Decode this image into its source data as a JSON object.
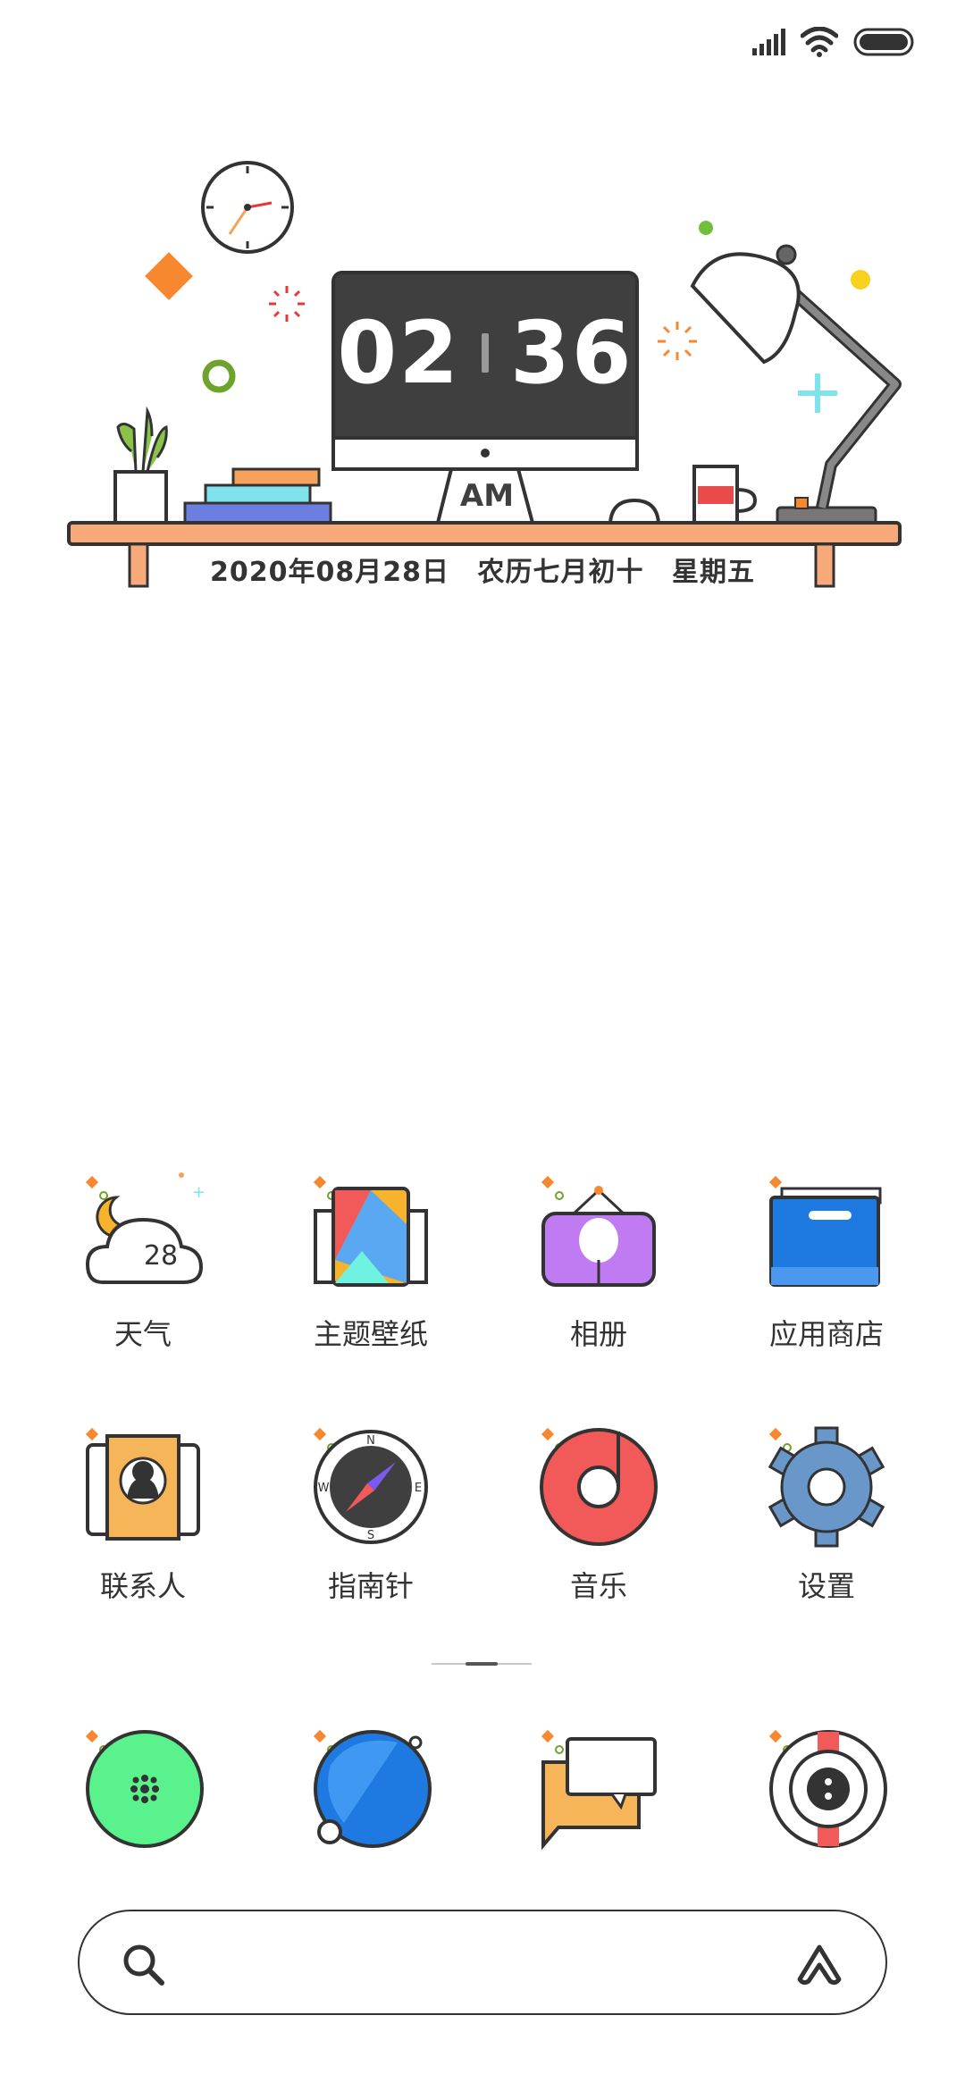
{
  "status_bar": {
    "icons": [
      "signal-icon",
      "wifi-icon",
      "battery-icon"
    ]
  },
  "clock_widget": {
    "hours": "02",
    "minutes": "36",
    "ampm": "AM",
    "date_parts": [
      "2020年08月28日",
      "农历七月初十",
      "星期五"
    ]
  },
  "apps": [
    {
      "name": "天气",
      "icon": "weather-icon",
      "badge": "28"
    },
    {
      "name": "主题壁纸",
      "icon": "themes-icon"
    },
    {
      "name": "相册",
      "icon": "gallery-icon"
    },
    {
      "name": "应用商店",
      "icon": "app-store-icon"
    },
    {
      "name": "联系人",
      "icon": "contacts-icon"
    },
    {
      "name": "指南针",
      "icon": "compass-icon",
      "compass": [
        "N",
        "E",
        "S",
        "W"
      ]
    },
    {
      "name": "音乐",
      "icon": "music-icon"
    },
    {
      "name": "设置",
      "icon": "settings-icon"
    }
  ],
  "dock": [
    {
      "icon": "phone-icon"
    },
    {
      "icon": "browser-icon"
    },
    {
      "icon": "messages-icon"
    },
    {
      "icon": "camera-icon"
    }
  ],
  "search": {
    "placeholder": "",
    "left_icon": "search-icon",
    "right_icon": "assistant-icon"
  },
  "colors": {
    "desk": "#f7a97a",
    "monitor": "#3f3f3f",
    "accent_orange": "#f7882f",
    "accent_green": "#6fa22a",
    "accent_cyan": "#7fe3ee"
  }
}
